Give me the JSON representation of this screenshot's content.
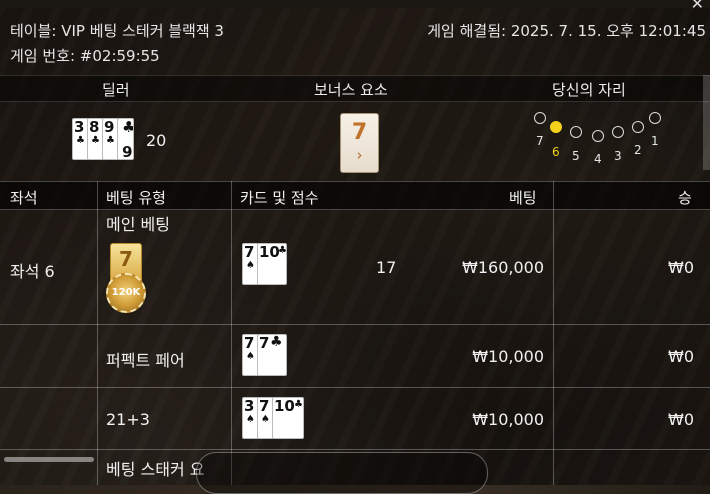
{
  "header": {
    "table_label": "테이블: VIP 베팅 스테커 블랙잭 3",
    "resolved_label": "게임 해결됨: 2025. 7. 15. 오후 12:01:45",
    "game_number_label": "게임 번호: #02:59:55"
  },
  "sections": {
    "dealer": "딜러",
    "bonus": "보너스 요소",
    "your_seat": "당신의 자리"
  },
  "dealer": {
    "cards": [
      {
        "rank": "3",
        "suit": "♣"
      },
      {
        "rank": "8",
        "suit": "♣"
      },
      {
        "rank": "9",
        "suit": "♣"
      },
      {
        "rank": "6",
        "suit": "♣"
      }
    ],
    "score": "20"
  },
  "bonus_card": {
    "rank": "7",
    "symbol": "›"
  },
  "seats": {
    "labels": [
      "7",
      "6",
      "5",
      "4",
      "3",
      "2",
      "1"
    ],
    "active": "6"
  },
  "table": {
    "columns": [
      "좌석",
      "베팅 유형",
      "카드 및 점수",
      "베팅",
      "승"
    ],
    "seat_label": "좌석 6",
    "rows": [
      {
        "bet_type": "메인 베팅",
        "chip_value": "120K",
        "chip_rank": "7",
        "cards": [
          {
            "rank": "7",
            "suit": "♠"
          },
          {
            "rank": "10",
            "suit": "♣"
          }
        ],
        "score": "17",
        "bet": "₩160,000",
        "win": "₩0"
      },
      {
        "bet_type": "퍼펙트 페어",
        "cards": [
          {
            "rank": "7",
            "suit": "♠"
          },
          {
            "rank": "7",
            "suit": "♣"
          }
        ],
        "bet": "₩10,000",
        "win": "₩0"
      },
      {
        "bet_type": "21+3",
        "cards": [
          {
            "rank": "3",
            "suit": "♠"
          },
          {
            "rank": "7",
            "suit": "♠"
          },
          {
            "rank": "10",
            "suit": "♣"
          }
        ],
        "bet": "₩10,000",
        "win": "₩0"
      },
      {
        "bet_type": "베팅 스태커 요"
      }
    ]
  },
  "colors": {
    "accent": "#f4d21c",
    "chip": "#cf9a35"
  },
  "icons": {
    "close": "close-icon"
  }
}
